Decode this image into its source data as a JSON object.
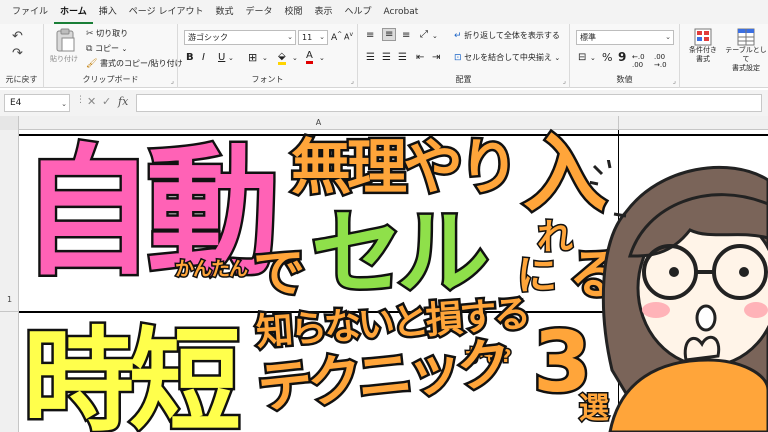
{
  "menu": {
    "tabs": [
      "ファイル",
      "ホーム",
      "挿入",
      "ページ レイアウト",
      "数式",
      "データ",
      "校閲",
      "表示",
      "ヘルプ",
      "Acrobat"
    ],
    "active": "ホーム"
  },
  "ribbon": {
    "undo_group_label": "元に戻す",
    "paste_label": "貼り付け",
    "cut_label": "切り取り",
    "copy_label": "コピー",
    "format_painter_label": "書式のコピー/貼り付け",
    "clipboard_group_label": "クリップボード",
    "font_name": "游ゴシック",
    "font_size": "11",
    "bold": "B",
    "italic": "I",
    "underline": "U",
    "font_group_label": "フォント",
    "wrap_text_label": "折り返して全体を表示する",
    "merge_center_label": "セルを結合して中央揃え",
    "alignment_group_label": "配置",
    "number_format": "標準",
    "number_group_label": "数値",
    "conditional_format_label": [
      "条件付き",
      "書式"
    ],
    "format_as_table_label": [
      "テーブルとして",
      "書式設定"
    ]
  },
  "formula_bar": {
    "name_box": "E4",
    "formula": ""
  },
  "grid": {
    "column_header": "A",
    "row_header": "1"
  },
  "thumbnail": {
    "line1": {
      "jidou": "自動",
      "muri": "無理やり",
      "ireru": "入",
      "re": "れ",
      "kantan": "かんたん",
      "de": "で",
      "seru": "セル",
      "ni": "に",
      "ru": "る"
    },
    "line2": {
      "jitan": "時短",
      "shiranai": "知らないと損する",
      "kamo": "かも?",
      "technic": "テクニック",
      "three": "3",
      "sen": "選"
    },
    "colors": {
      "pink": "#ff62b6",
      "orange": "#ffa53a",
      "green": "#8fe04a",
      "yellow": "#ffff4c",
      "outline": "#111111"
    }
  }
}
